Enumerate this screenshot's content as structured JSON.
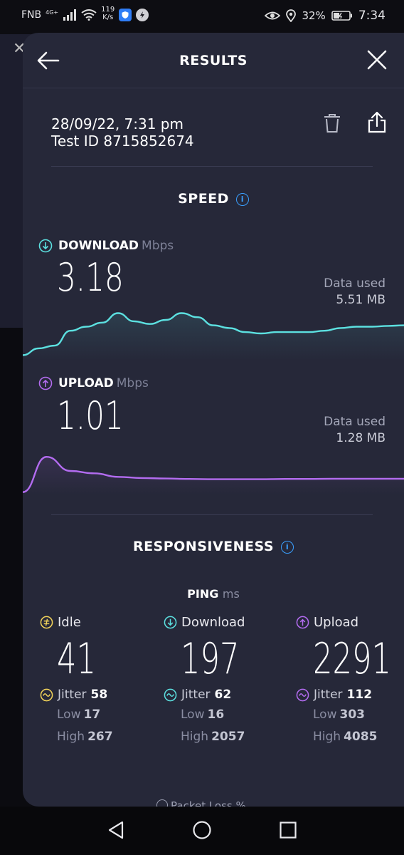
{
  "status_bar": {
    "carrier": "FNB",
    "network_type": "4G+",
    "net_speed_value": "119",
    "net_speed_unit": "K/s",
    "battery": "32%",
    "time": "7:34"
  },
  "header": {
    "title": "RESULTS"
  },
  "test": {
    "datetime": "28/09/22, 7:31 pm",
    "test_id": "Test ID 8715852674"
  },
  "speed": {
    "title": "SPEED",
    "download": {
      "label": "DOWNLOAD",
      "unit": "Mbps",
      "value": "3.18",
      "data_used_label": "Data used",
      "data_used_value": "5.51 MB",
      "color": "#5ce0e0"
    },
    "upload": {
      "label": "UPLOAD",
      "unit": "Mbps",
      "value": "1.01",
      "data_used_label": "Data used",
      "data_used_value": "1.28 MB",
      "color": "#b36cf0"
    }
  },
  "responsiveness": {
    "title": "RESPONSIVENESS",
    "ping_label": "PING",
    "ping_unit": "ms",
    "columns": [
      {
        "label": "Idle",
        "value": "41",
        "jitter_label": "Jitter",
        "jitter": "58",
        "low_label": "Low",
        "low": "17",
        "high_label": "High",
        "high": "267",
        "color": "#f2d35a"
      },
      {
        "label": "Download",
        "value": "197",
        "jitter_label": "Jitter",
        "jitter": "62",
        "low_label": "Low",
        "low": "16",
        "high_label": "High",
        "high": "2057",
        "color": "#5ce0e0"
      },
      {
        "label": "Upload",
        "value": "2291",
        "jitter_label": "Jitter",
        "jitter": "112",
        "low_label": "Low",
        "low": "303",
        "high_label": "High",
        "high": "4085",
        "color": "#b36cf0"
      }
    ]
  },
  "partial_row_text": "Packet Loss %",
  "chart_data": [
    {
      "type": "area",
      "name": "download-speed-graph",
      "color": "#5ce0e0",
      "values": [
        0.2,
        0.45,
        0.55,
        1.1,
        1.25,
        1.4,
        1.75,
        1.45,
        1.35,
        1.5,
        1.75,
        1.6,
        1.3,
        1.2,
        1.05,
        1.0,
        1.05,
        1.05,
        1.05,
        1.1,
        1.2,
        1.25,
        1.25,
        1.28,
        1.3
      ],
      "ylim": [
        0,
        2
      ]
    },
    {
      "type": "area",
      "name": "upload-speed-graph",
      "color": "#b36cf0",
      "values": [
        0.1,
        1.6,
        1.0,
        0.9,
        0.75,
        0.7,
        0.68,
        0.66,
        0.65,
        0.65,
        0.65,
        0.66,
        0.66,
        0.67,
        0.67,
        0.67,
        0.67
      ],
      "ylim": [
        0,
        2
      ]
    }
  ]
}
